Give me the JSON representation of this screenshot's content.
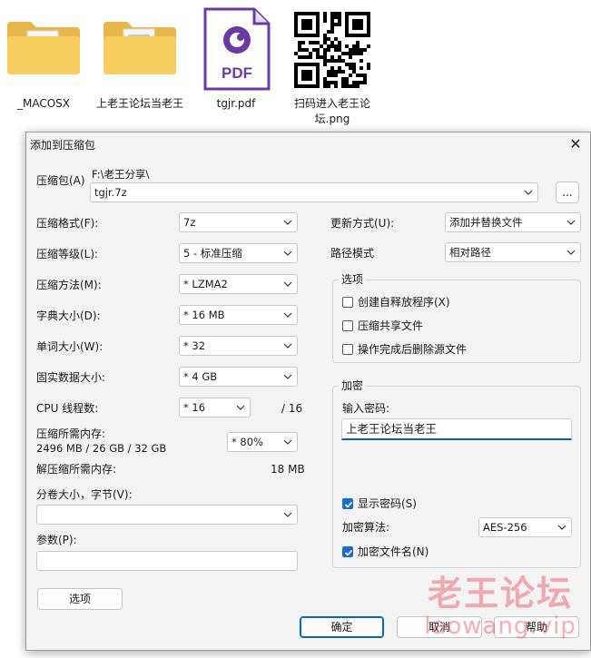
{
  "desktop": {
    "icons": [
      {
        "label": "_MACOSX",
        "icon": "folder-icon"
      },
      {
        "label": "上老王论坛当老王",
        "icon": "folder-icon"
      },
      {
        "label": "tgjr.pdf",
        "icon": "pdf-file-icon"
      },
      {
        "label": "扫码进入老王论坛.png",
        "icon": "qr-code-image-icon"
      }
    ],
    "pdf_badge": "PDF"
  },
  "dialog": {
    "title": "添加到压缩包",
    "close_glyph": "✕",
    "archive": {
      "label": "压缩包(A)",
      "path": "F:\\老王分享\\",
      "name": "tgjr.7z",
      "browse_label": "..."
    },
    "left": {
      "format": {
        "label": "压缩格式(F):",
        "value": "7z"
      },
      "level": {
        "label": "压缩等级(L):",
        "value": "5 - 标准压缩"
      },
      "method": {
        "label": "压缩方法(M):",
        "value": "*  LZMA2"
      },
      "dict": {
        "label": "字典大小(D):",
        "value": "*  16 MB"
      },
      "word": {
        "label": "单词大小(W):",
        "value": "*  32"
      },
      "solid": {
        "label": "固实数据大小:",
        "value": "*  4 GB"
      },
      "cpu": {
        "label": "CPU 线程数:",
        "value": "*  16",
        "total": "/ 16"
      },
      "mem_compress": {
        "label": "压缩所需内存:",
        "detail": "2496 MB / 26 GB / 32 GB",
        "value": "*  80%"
      },
      "mem_decompress": {
        "label": "解压缩所需内存:",
        "value": "18 MB"
      },
      "split": {
        "label": "分卷大小，字节(V):",
        "value": ""
      },
      "params": {
        "label": "参数(P):",
        "value": ""
      },
      "options_button": "选项"
    },
    "right": {
      "update": {
        "label": "更新方式(U):",
        "value": "添加并替换文件"
      },
      "pathmode": {
        "label": "路径模式",
        "value": "相对路径"
      },
      "options_group": {
        "title": "选项",
        "sfx": {
          "label": "创建自释放程序(X)",
          "checked": false
        },
        "shared": {
          "label": "压缩共享文件",
          "checked": false
        },
        "delete": {
          "label": "操作完成后删除源文件",
          "checked": false
        }
      },
      "encrypt_group": {
        "title": "加密",
        "password_label": "输入密码:",
        "password_value": "上老王论坛当老王",
        "show_password": {
          "label": "显示密码(S)",
          "checked": true
        },
        "method": {
          "label": "加密算法:",
          "value": "AES-256"
        },
        "encrypt_names": {
          "label": "加密文件名(N)",
          "checked": true
        }
      }
    },
    "buttons": {
      "ok": "确定",
      "cancel": "取消",
      "help": "帮助"
    }
  },
  "watermark": {
    "line1": "老王论坛",
    "line2": "laowang.vip"
  },
  "colors": {
    "accent": "#1c6cc8",
    "dialog_bg": "#f3f3f3",
    "watermark": "#eb505a"
  }
}
